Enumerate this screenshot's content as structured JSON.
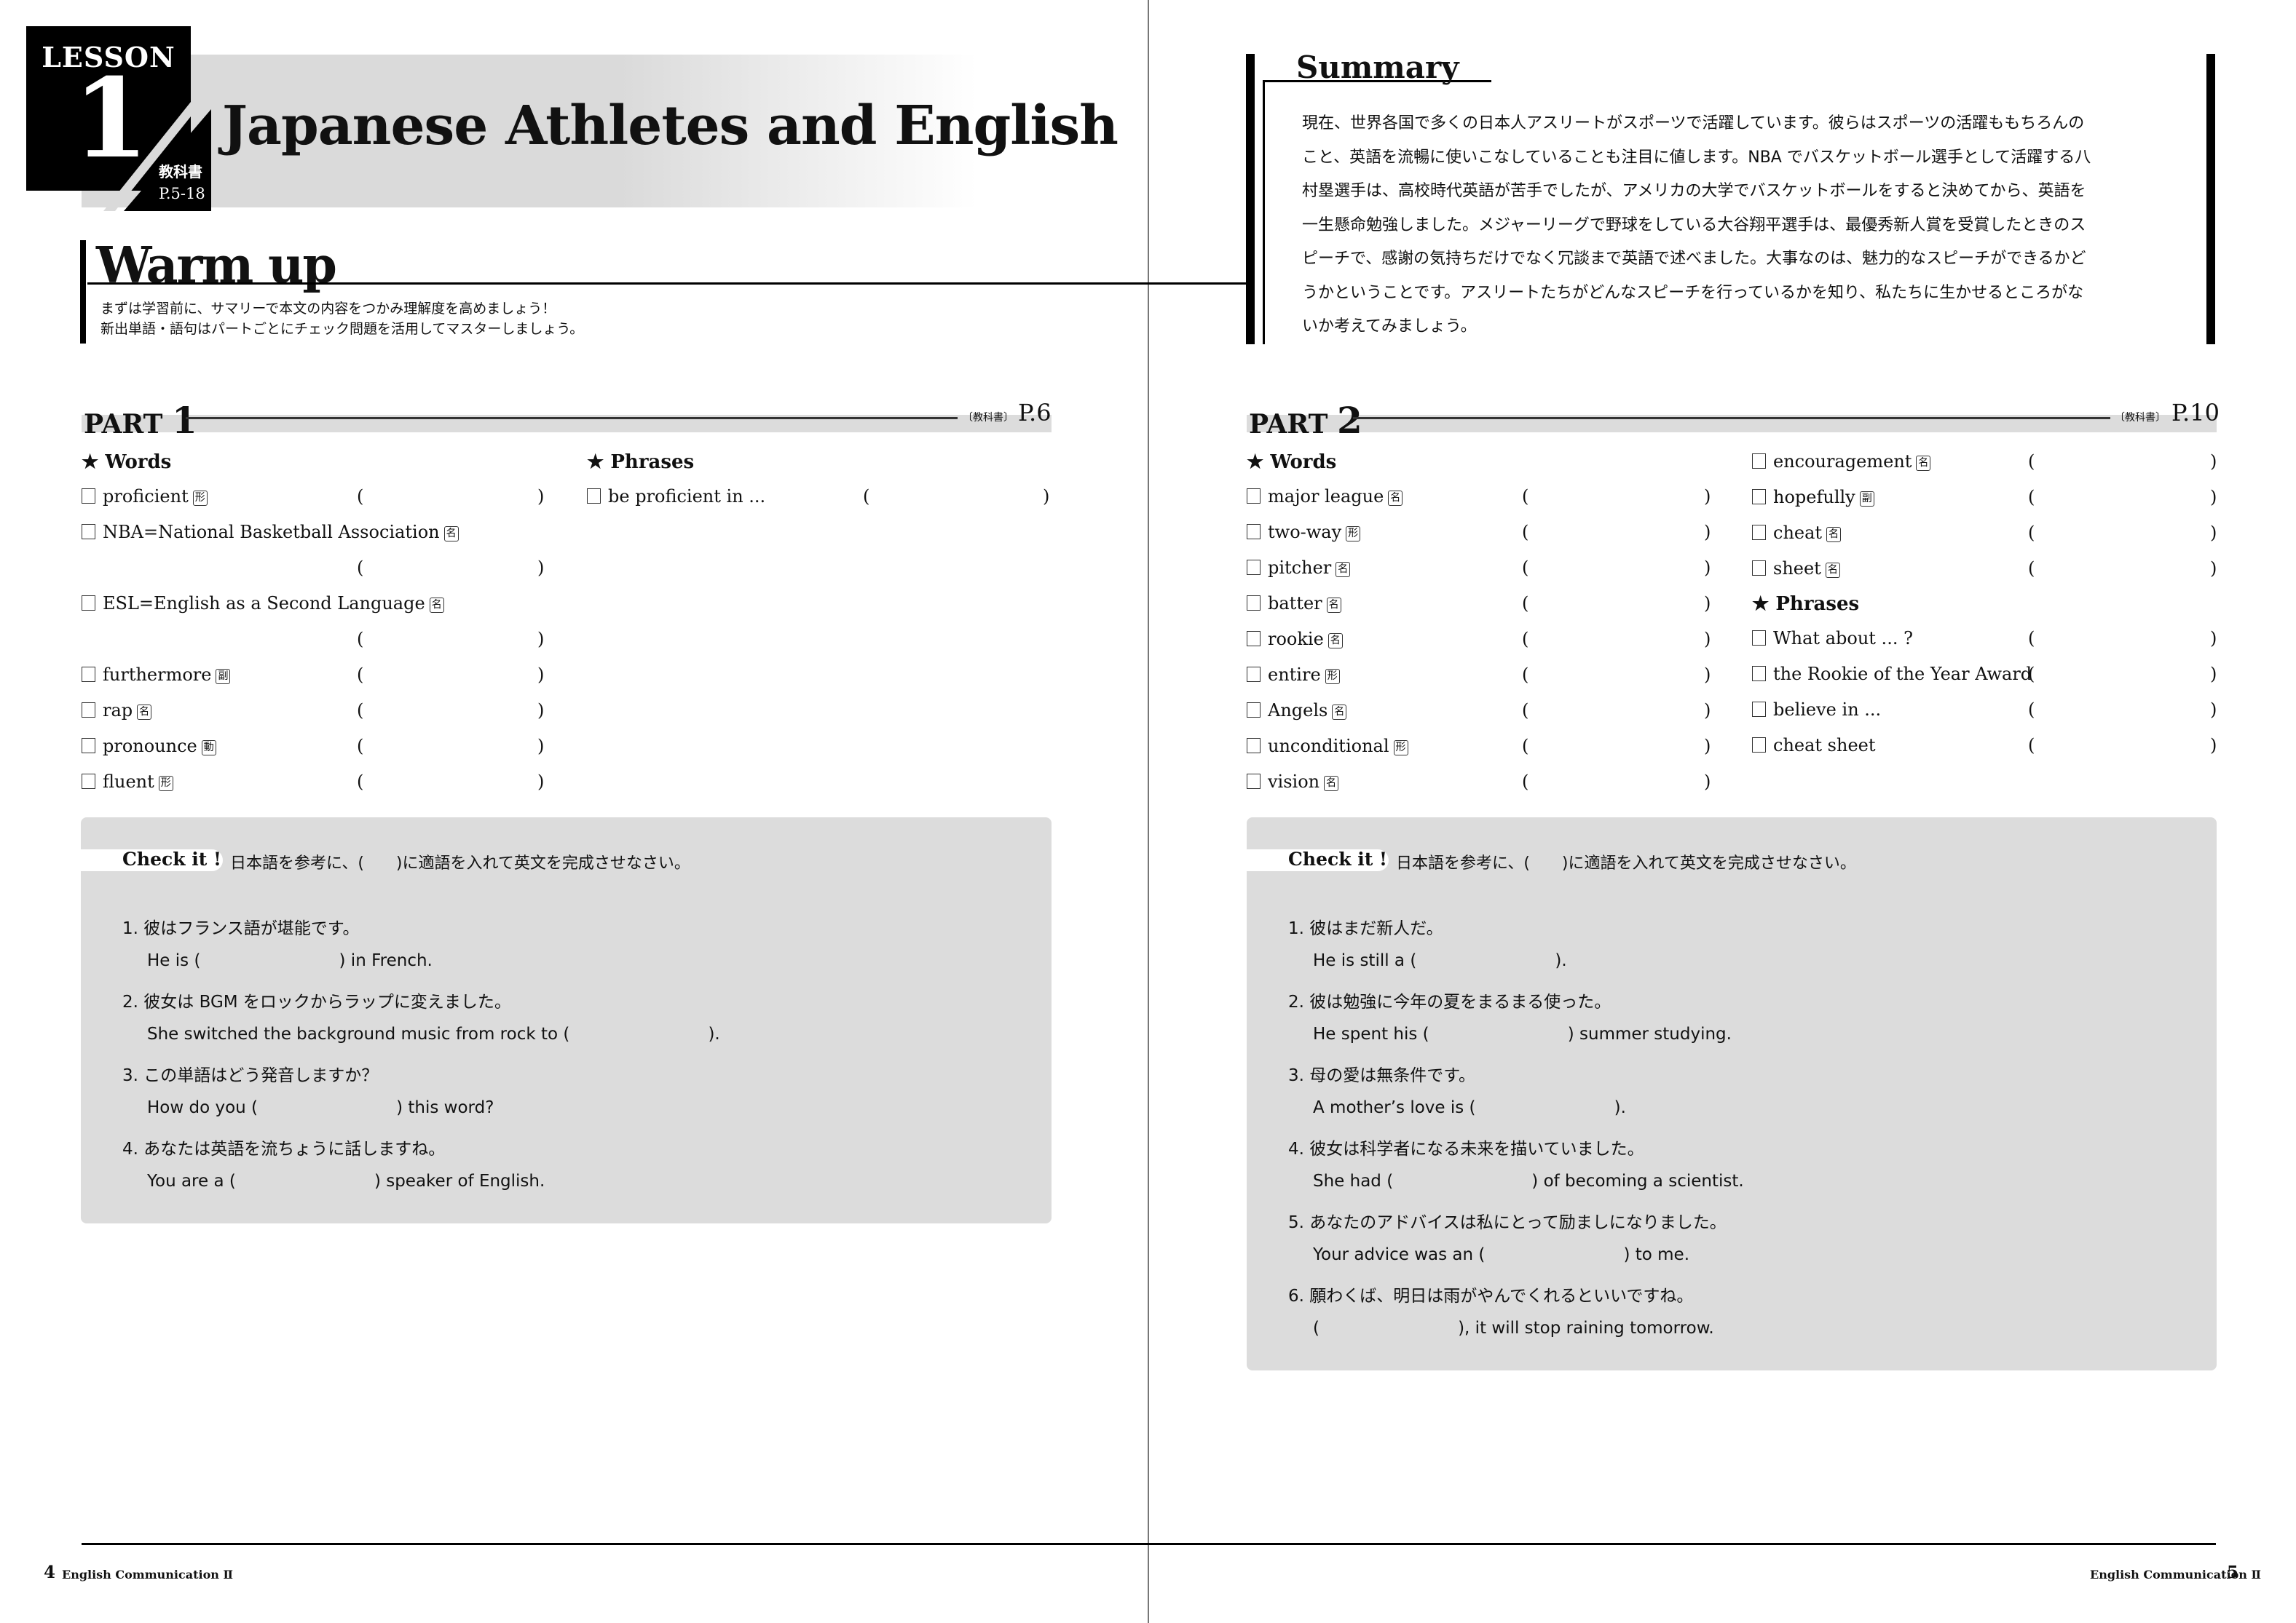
{
  "lesson": {
    "word": "LESSON",
    "number": "1",
    "textbook_label": "教科書",
    "pages": "P.5-18",
    "title": "Japanese Athletes and English"
  },
  "warmup": {
    "title": "Warm up",
    "lines": [
      "まずは学習前に、サマリーで本文の内容をつかみ理解度を高めましょう！",
      "新出単語・語句はパートごとにチェック問題を活用してマスターしましょう。"
    ]
  },
  "summary": {
    "title": "Summary",
    "lines": [
      "現在、世界各国で多くの日本人アスリートがスポーツで活躍しています。彼らはスポーツの活躍ももちろんの",
      "こと、英語を流暢に使いこなしていることも注目に値します。NBA でバスケットボール選手として活躍する八",
      "村塁選手は、高校時代英語が苦手でしたが、アメリカの大学でバスケットボールをすると決めてから、英語を",
      "一生懸命勉強しました。メジャーリーグで野球をしている大谷翔平選手は、最優秀新人賞を受賞したときのス",
      "ピーチで、感謝の気持ちだけでなく冗談まで英語で述べました。大事なのは、魅力的なスピーチができるかど",
      "うかということです。アスリートたちがどんなスピーチを行っているかを知り、私たちに生かせるところがな",
      "いか考えてみましょう。"
    ]
  },
  "part1": {
    "label": "PART",
    "number": "1",
    "ref_label": "〔教科書〕",
    "page": "P.6",
    "words_heading": "★ Words",
    "phrases_heading": "★ Phrases",
    "words": [
      {
        "term": "proficient",
        "pos": "形",
        "blank_same_line": true
      },
      {
        "term": "NBA=National Basketball Association",
        "pos": "名",
        "blank_same_line": false
      },
      {
        "term": "ESL=English as a Second Language",
        "pos": "名",
        "blank_same_line": false
      },
      {
        "term": "furthermore",
        "pos": "副",
        "blank_same_line": true
      },
      {
        "term": "rap",
        "pos": "名",
        "blank_same_line": true
      },
      {
        "term": "pronounce",
        "pos": "動",
        "blank_same_line": true
      },
      {
        "term": "fluent",
        "pos": "形",
        "blank_same_line": true
      }
    ],
    "phrases": [
      {
        "term": "be proficient in ..."
      }
    ],
    "check": {
      "label": "Check it !",
      "instruction": "日本語を参考に、(　　)に適語を入れて英文を完成させなさい。",
      "items": [
        {
          "num": "1.",
          "jp": "彼はフランス語が堪能です。",
          "en_before": "He is (",
          "en_after": ") in French."
        },
        {
          "num": "2.",
          "jp": "彼女は BGM をロックからラップに変えました。",
          "en_before": "She switched the background music from rock to (",
          "en_after": ")."
        },
        {
          "num": "3.",
          "jp": "この単語はどう発音しますか？",
          "en_before": "How do you (",
          "en_after": ") this word?"
        },
        {
          "num": "4.",
          "jp": "あなたは英語を流ちょうに話しますね。",
          "en_before": "You are a (",
          "en_after": ") speaker of English."
        }
      ]
    }
  },
  "part2": {
    "label": "PART",
    "number": "2",
    "ref_label": "〔教科書〕",
    "page": "P.10",
    "words_heading": "★ Words",
    "phrases_heading": "★ Phrases",
    "words_left": [
      {
        "term": "major league",
        "pos": "名"
      },
      {
        "term": "two-way",
        "pos": "形"
      },
      {
        "term": "pitcher",
        "pos": "名"
      },
      {
        "term": "batter",
        "pos": "名"
      },
      {
        "term": "rookie",
        "pos": "名"
      },
      {
        "term": "entire",
        "pos": "形"
      },
      {
        "term": "Angels",
        "pos": "名"
      },
      {
        "term": "unconditional",
        "pos": "形"
      },
      {
        "term": "vision",
        "pos": "名"
      }
    ],
    "words_right": [
      {
        "term": "encouragement",
        "pos": "名"
      },
      {
        "term": "hopefully",
        "pos": "副"
      },
      {
        "term": "cheat",
        "pos": "名"
      },
      {
        "term": "sheet",
        "pos": "名"
      }
    ],
    "phrases": [
      {
        "term": "What about ... ?"
      },
      {
        "term": "the Rookie of the Year Award"
      },
      {
        "term": "believe in ..."
      },
      {
        "term": "cheat sheet"
      }
    ],
    "check": {
      "label": "Check it !",
      "instruction": "日本語を参考に、(　　)に適語を入れて英文を完成させなさい。",
      "items": [
        {
          "num": "1.",
          "jp": "彼はまだ新人だ。",
          "en_before": "He is still a (",
          "en_after": ")."
        },
        {
          "num": "2.",
          "jp": "彼は勉強に今年の夏をまるまる使った。",
          "en_before": "He spent his (",
          "en_after": ") summer studying."
        },
        {
          "num": "3.",
          "jp": "母の愛は無条件です。",
          "en_before": "A mother’s love is (",
          "en_after": ")."
        },
        {
          "num": "4.",
          "jp": "彼女は科学者になる未来を描いていました。",
          "en_before": "She had (",
          "en_after": ") of becoming a scientist."
        },
        {
          "num": "5.",
          "jp": "あなたのアドバイスは私にとって励ましになりました。",
          "en_before": "Your advice was an (",
          "en_after": ") to me."
        },
        {
          "num": "6.",
          "jp": "願わくば、明日は雨がやんでくれるといいですね。",
          "en_before": "(",
          "en_after": "), it will stop raining tomorrow."
        }
      ]
    }
  },
  "footer": {
    "left_page": "4",
    "right_page": "5",
    "book_title": "English Communication Ⅱ"
  },
  "glyphs": {
    "checkbox": "checkbox-icon",
    "open_paren": "(",
    "close_paren": ")"
  }
}
